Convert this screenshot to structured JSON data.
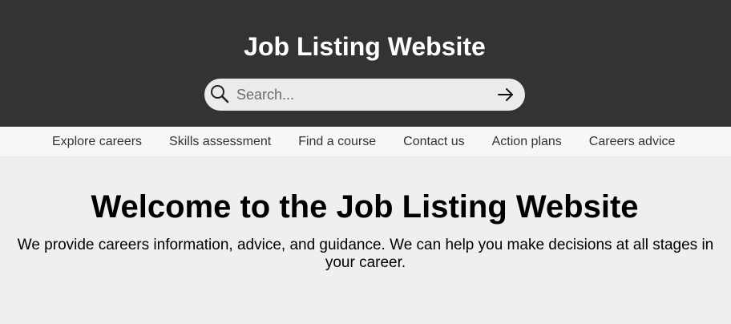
{
  "header": {
    "title": "Job Listing Website",
    "background": "#333333",
    "search": {
      "placeholder": "Search...",
      "value": "",
      "icon": "search-icon",
      "submit_icon": "arrow-right-icon"
    }
  },
  "nav": {
    "items": [
      {
        "label": "Explore careers"
      },
      {
        "label": "Skills assessment"
      },
      {
        "label": "Find a course"
      },
      {
        "label": "Contact us"
      },
      {
        "label": "Action plans"
      },
      {
        "label": "Careers advice"
      }
    ]
  },
  "main": {
    "heading": "Welcome to the Job Listing Website",
    "intro": "We provide careers information, advice, and guidance. We can help you make decisions at all stages in your career."
  }
}
